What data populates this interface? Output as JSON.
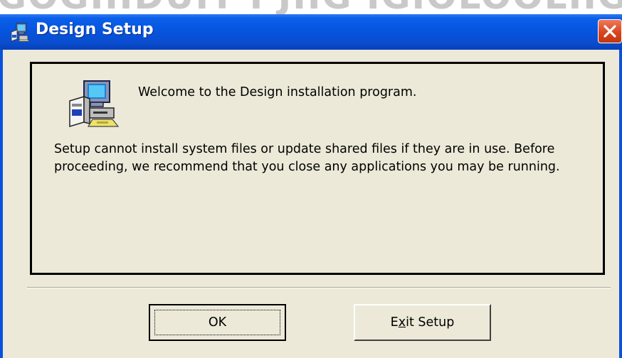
{
  "background": {
    "cut_text": "GOGIIIDUIT I JIIG IGIOLOOLIIG"
  },
  "window": {
    "title": "Design Setup",
    "title_icon": "setup-computer-icon",
    "close_icon": "close-icon"
  },
  "content": {
    "icon": "setup-computer-icon",
    "welcome": "Welcome to the Design installation program.",
    "message": "Setup cannot install system files or update shared files if they are in use. Before proceeding, we recommend that you close any applications you may be running."
  },
  "buttons": {
    "ok_label": "OK",
    "exit_prefix": "E",
    "exit_mnemonic": "x",
    "exit_suffix": "it Setup"
  },
  "colors": {
    "titlebar": "#0655df",
    "close_button": "#d8461f",
    "dialog_face": "#ece9d8"
  }
}
